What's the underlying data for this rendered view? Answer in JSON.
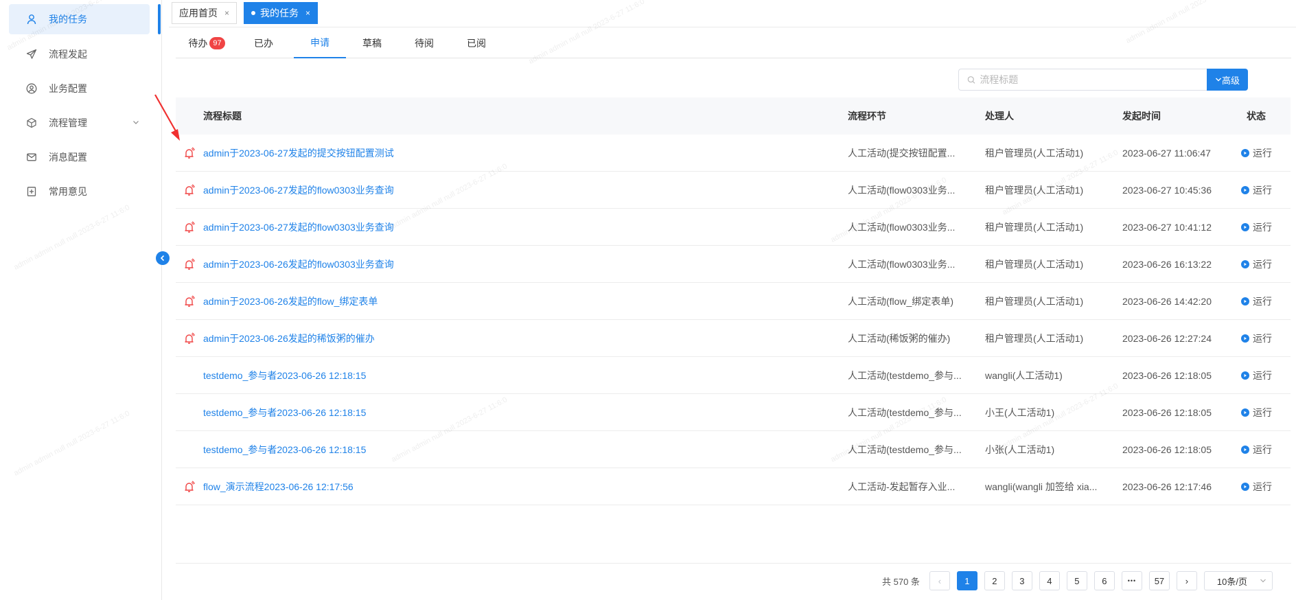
{
  "sidebar": {
    "items": [
      {
        "label": "我的任务",
        "icon": "user-icon",
        "active": true
      },
      {
        "label": "流程发起",
        "icon": "paper-plane-icon"
      },
      {
        "label": "业务配置",
        "icon": "user-circle-icon"
      },
      {
        "label": "流程管理",
        "icon": "cube-icon",
        "expandable": true
      },
      {
        "label": "消息配置",
        "icon": "mail-icon"
      },
      {
        "label": "常用意见",
        "icon": "plus-square-icon"
      }
    ]
  },
  "page_tabs": [
    {
      "label": "应用首页",
      "close": "×"
    },
    {
      "label": "我的任务",
      "close": "×",
      "active": true
    }
  ],
  "subtabs": [
    {
      "label": "待办",
      "badge": "97"
    },
    {
      "label": "已办"
    },
    {
      "label": "申请",
      "active": true
    },
    {
      "label": "草稿"
    },
    {
      "label": "待阅"
    },
    {
      "label": "已阅"
    }
  ],
  "search": {
    "placeholder": "流程标题",
    "advanced_label": "高级"
  },
  "table": {
    "headers": {
      "title": "流程标题",
      "node": "流程环节",
      "handler": "处理人",
      "time": "发起时间",
      "status": "状态"
    },
    "rows": [
      {
        "urge": true,
        "title": "admin于2023-06-27发起的提交按钮配置测试",
        "node": "人工活动(提交按钮配置...",
        "handler": "租户管理员(人工活动1)",
        "time": "2023-06-27 11:06:47",
        "status": "运行"
      },
      {
        "urge": true,
        "title": "admin于2023-06-27发起的flow0303业务查询",
        "node": "人工活动(flow0303业务...",
        "handler": "租户管理员(人工活动1)",
        "time": "2023-06-27 10:45:36",
        "status": "运行"
      },
      {
        "urge": true,
        "title": "admin于2023-06-27发起的flow0303业务查询",
        "node": "人工活动(flow0303业务...",
        "handler": "租户管理员(人工活动1)",
        "time": "2023-06-27 10:41:12",
        "status": "运行"
      },
      {
        "urge": true,
        "title": "admin于2023-06-26发起的flow0303业务查询",
        "node": "人工活动(flow0303业务...",
        "handler": "租户管理员(人工活动1)",
        "time": "2023-06-26 16:13:22",
        "status": "运行"
      },
      {
        "urge": true,
        "title": "admin于2023-06-26发起的flow_绑定表单",
        "node": "人工活动(flow_绑定表单)",
        "handler": "租户管理员(人工活动1)",
        "time": "2023-06-26 14:42:20",
        "status": "运行"
      },
      {
        "urge": true,
        "title": "admin于2023-06-26发起的稀饭粥的催办",
        "node": "人工活动(稀饭粥的催办)",
        "handler": "租户管理员(人工活动1)",
        "time": "2023-06-26 12:27:24",
        "status": "运行"
      },
      {
        "urge": false,
        "title": "testdemo_参与者2023-06-26 12:18:15",
        "node": "人工活动(testdemo_参与...",
        "handler": "wangli(人工活动1)",
        "time": "2023-06-26 12:18:05",
        "status": "运行"
      },
      {
        "urge": false,
        "title": "testdemo_参与者2023-06-26 12:18:15",
        "node": "人工活动(testdemo_参与...",
        "handler": "小王(人工活动1)",
        "time": "2023-06-26 12:18:05",
        "status": "运行"
      },
      {
        "urge": false,
        "title": "testdemo_参与者2023-06-26 12:18:15",
        "node": "人工活动(testdemo_参与...",
        "handler": "小张(人工活动1)",
        "time": "2023-06-26 12:18:05",
        "status": "运行"
      },
      {
        "urge": true,
        "title": "flow_演示流程2023-06-26 12:17:56",
        "node": "人工活动-发起暂存入业...",
        "handler": "wangli(wangli 加签给 xia...",
        "time": "2023-06-26 12:17:46",
        "status": "运行"
      }
    ]
  },
  "pagination": {
    "total_text": "共 570 条",
    "prev": "‹",
    "next": "›",
    "pages": [
      "1",
      "2",
      "3",
      "4",
      "5",
      "6",
      "•••",
      "57"
    ],
    "current": "1",
    "page_size": "10条/页"
  },
  "watermark": "admin admin null null 2023-6-27 11:6:0",
  "colors": {
    "accent": "#1f82e8",
    "urge": "#f04444",
    "badge": "#f04444"
  }
}
